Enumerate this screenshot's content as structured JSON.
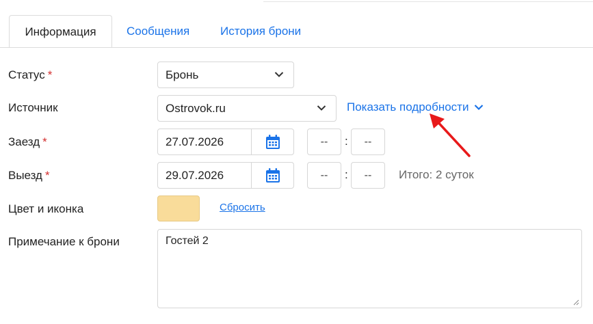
{
  "tabs": [
    {
      "label": "Информация",
      "active": true
    },
    {
      "label": "Сообщения",
      "active": false
    },
    {
      "label": "История брони",
      "active": false
    }
  ],
  "form": {
    "status": {
      "label": "Статус",
      "required_mark": "*",
      "value": "Бронь"
    },
    "source": {
      "label": "Источник",
      "value": "Ostrovok.ru",
      "details_link": "Показать подробности"
    },
    "checkin": {
      "label": "Заезд",
      "required_mark": "*",
      "date": "27.07.2026",
      "hour": "--",
      "minute": "--"
    },
    "checkout": {
      "label": "Выезд",
      "required_mark": "*",
      "date": "29.07.2026",
      "hour": "--",
      "minute": "--",
      "total": "Итого: 2 суток"
    },
    "color": {
      "label": "Цвет и иконка",
      "swatch_color": "#f9dc9a",
      "reset_label": "Сбросить"
    },
    "note": {
      "label": "Примечание к брони",
      "value": "Гостей 2"
    }
  },
  "colors": {
    "accent": "#1a73e8",
    "required": "#d32f2f",
    "annotation_arrow": "#e8191a"
  },
  "icons": {
    "calendar": "calendar-icon",
    "chevron": "chevron-down-icon"
  }
}
